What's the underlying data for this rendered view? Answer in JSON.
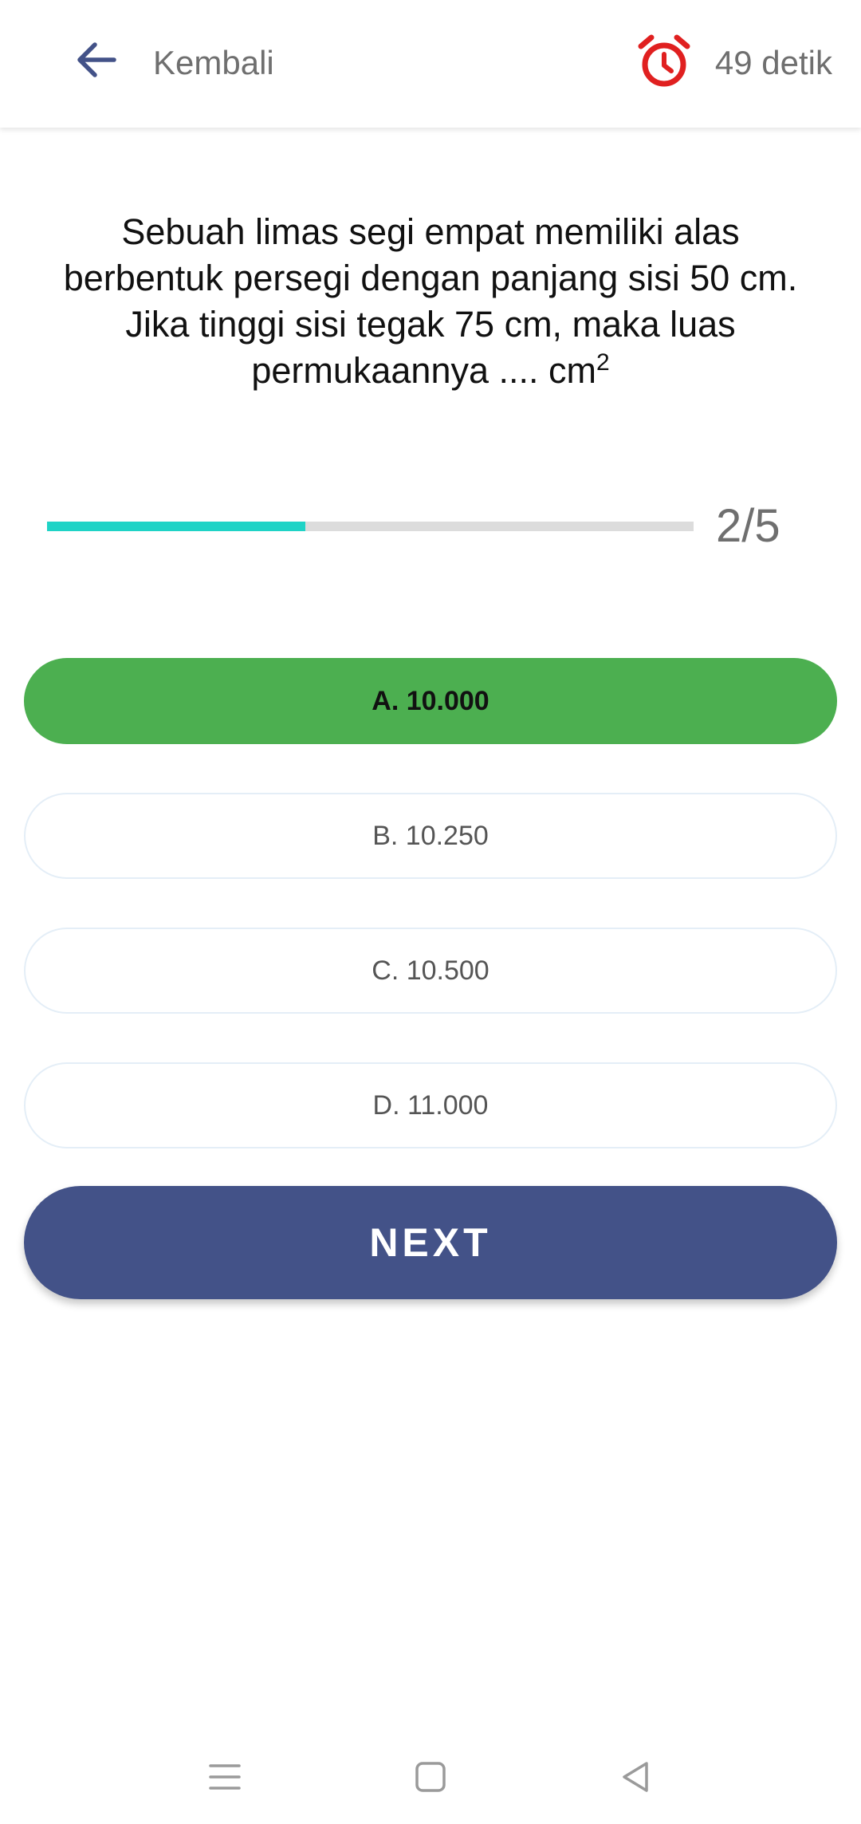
{
  "header": {
    "back_label": "Kembali",
    "timer_text": "49 detik"
  },
  "question": {
    "text": "Sebuah limas segi empat memiliki alas berbentuk persegi dengan panjang sisi 50 cm. Jika tinggi sisi tegak 75 cm, maka luas permukaannya ....  cm",
    "superscript": "2"
  },
  "progress": {
    "label": "2/5",
    "fraction": 0.4
  },
  "options": [
    {
      "label": "A. 10.000",
      "selected": true
    },
    {
      "label": "B. 10.250",
      "selected": false
    },
    {
      "label": "C. 10.500",
      "selected": false
    },
    {
      "label": "D. 11.000",
      "selected": false
    }
  ],
  "next_label": "NEXT",
  "colors": {
    "accent": "#435288",
    "progress": "#1fd3c6",
    "selected": "#4caf50",
    "timer": "#e02020"
  },
  "icons": {
    "back": "arrow-left-icon",
    "timer": "alarm-clock-icon",
    "nav_menu": "menu-icon",
    "nav_home": "home-square-icon",
    "nav_back": "triangle-back-icon"
  }
}
